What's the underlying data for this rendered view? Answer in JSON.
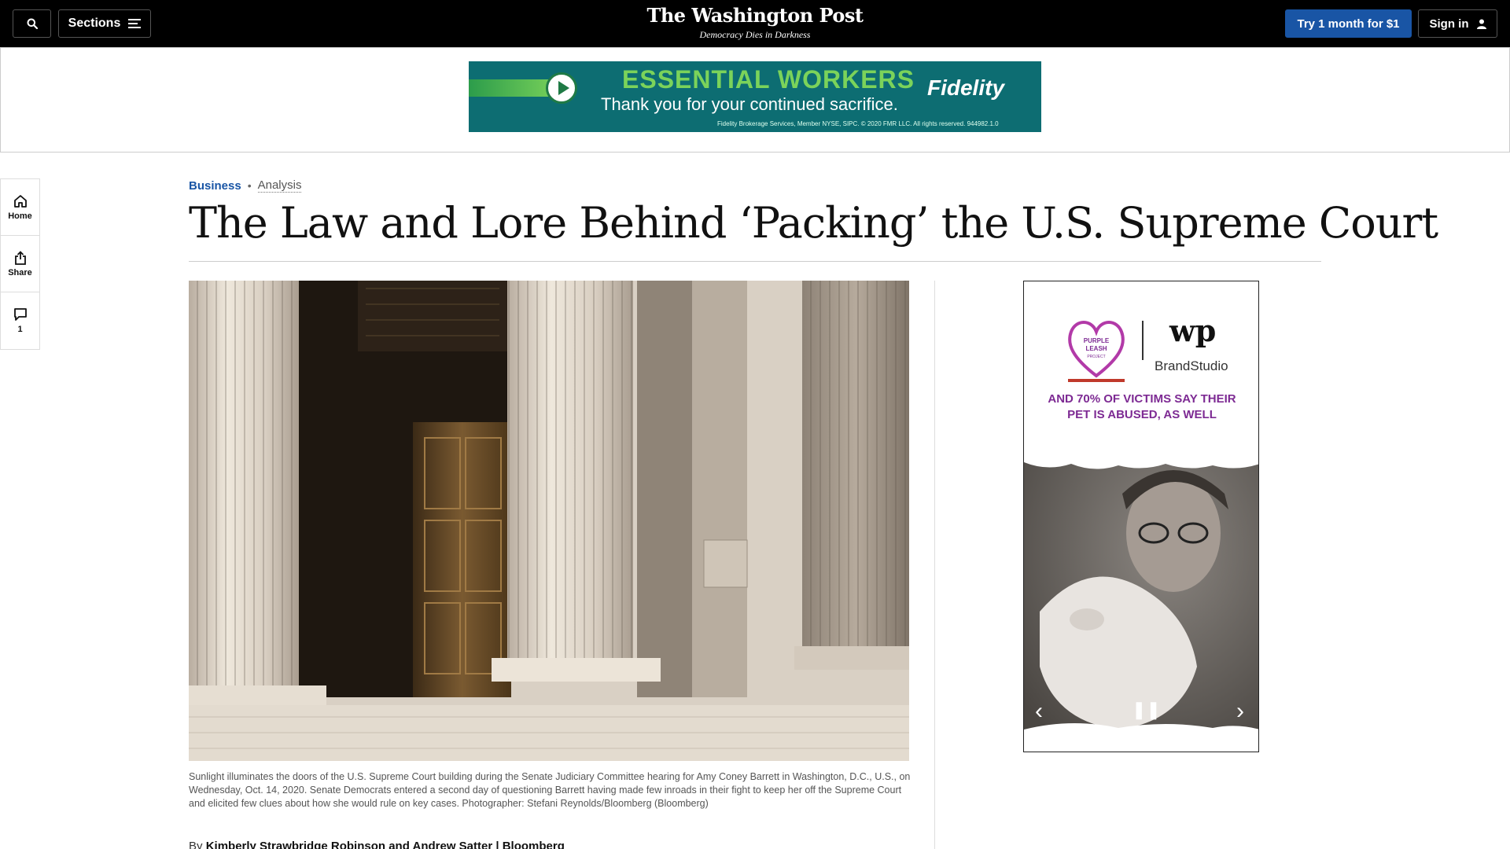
{
  "header": {
    "sections_label": "Sections",
    "masthead": "The Washington Post",
    "tagline": "Democracy Dies in Darkness",
    "subscribe_label": "Try 1 month for $1",
    "signin_label": "Sign in"
  },
  "top_ad": {
    "headline": "ESSENTIAL WORKERS",
    "subline": "Thank you for your continued sacrifice.",
    "brand": "Fidelity",
    "fine_print": "Fidelity Brokerage Services, Member NYSE, SIPC. © 2020 FMR LLC. All rights reserved. 944982.1.0",
    "accent_color": "#7bd35a",
    "background_color": "#0d6d72"
  },
  "left_rail": {
    "home_label": "Home",
    "share_label": "Share",
    "comments_count": "1"
  },
  "article": {
    "section": "Business",
    "label": "Analysis",
    "headline": "The Law and Lore Behind ‘Packing’ the U.S. Supreme Court",
    "caption": "Sunlight illuminates the doors of the U.S. Supreme Court building during the Senate Judiciary Committee hearing for Amy Coney Barrett in Washington, D.C., U.S., on Wednesday, Oct. 14, 2020. Senate Democrats entered a second day of questioning Barrett having made few inroads in their fight to keep her off the Supreme Court and elicited few clues about how she would rule on key cases. Photographer: Stefani Reynolds/Bloomberg (Bloomberg)",
    "byline_prefix": "By",
    "byline_authors": "Kimberly Strawbridge Robinson and Andrew Satter | Bloomberg"
  },
  "side_ad": {
    "partner_logo_text": "PURPLE LEASH PROJECT",
    "wp_logo": "wp",
    "brandstudio": "BrandStudio",
    "message": "AND 70% OF VICTIMS SAY THEIR PET IS ABUSED, AS WELL",
    "accent_color": "#7d2a93"
  },
  "colors": {
    "topbar_bg": "#000000",
    "subscribe_bg": "#1955a5",
    "section_link": "#1955a5"
  }
}
